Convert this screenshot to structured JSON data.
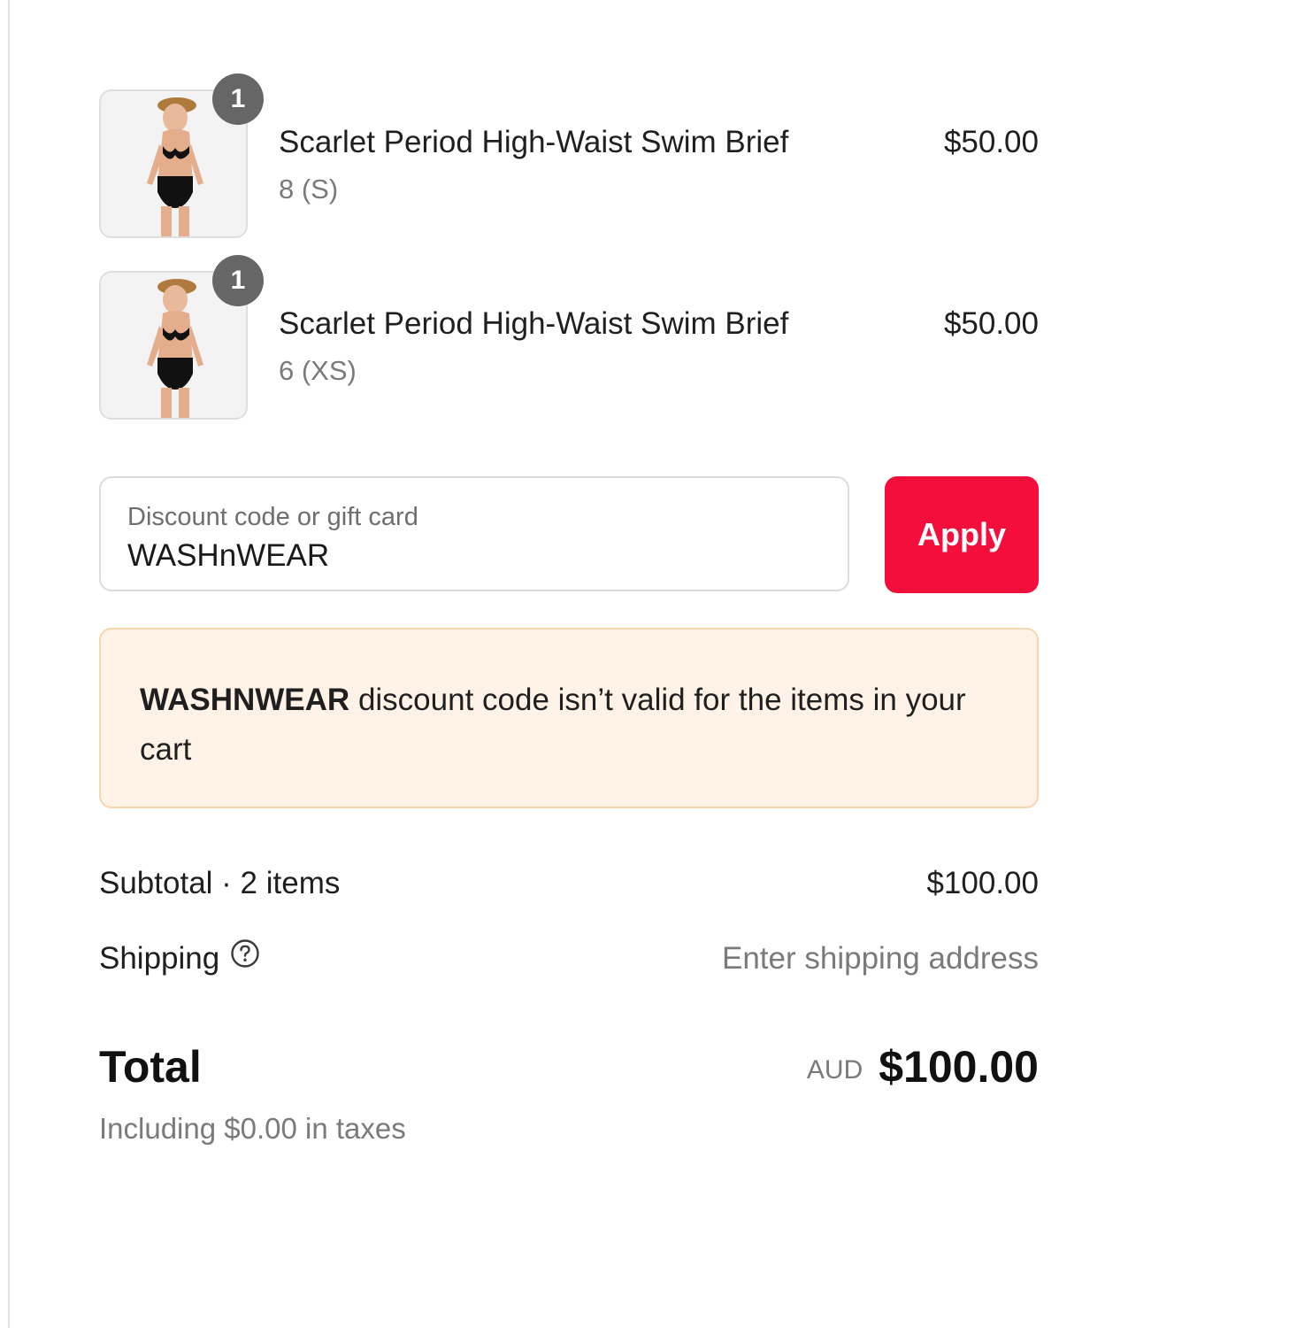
{
  "cart": {
    "items": [
      {
        "name": "Scarlet Period High-Waist Swim Brief",
        "variant": "8 (S)",
        "price": "$50.00",
        "quantity": "1"
      },
      {
        "name": "Scarlet Period High-Waist Swim Brief",
        "variant": "6 (XS)",
        "price": "$50.00",
        "quantity": "1"
      }
    ]
  },
  "discount": {
    "label": "Discount code or gift card",
    "value": "WASHnWEAR",
    "apply_label": "Apply",
    "error_code": "WASHNWEAR",
    "error_message": " discount code isn’t valid for the items in your cart"
  },
  "summary": {
    "subtotal_label": "Subtotal · 2 items",
    "subtotal_value": "$100.00",
    "shipping_label": "Shipping",
    "shipping_value": "Enter shipping address",
    "total_label": "Total",
    "currency": "AUD",
    "total_value": "$100.00",
    "taxes_note": "Including $0.00 in taxes"
  },
  "colors": {
    "apply_button": "#f40e3c",
    "error_background": "#fff3e8",
    "error_border": "#f8d5ad",
    "badge": "#666666"
  },
  "icons": {
    "product_thumbnail": "swimwear-model-thumbnail",
    "shipping_help": "question-circle-icon"
  }
}
